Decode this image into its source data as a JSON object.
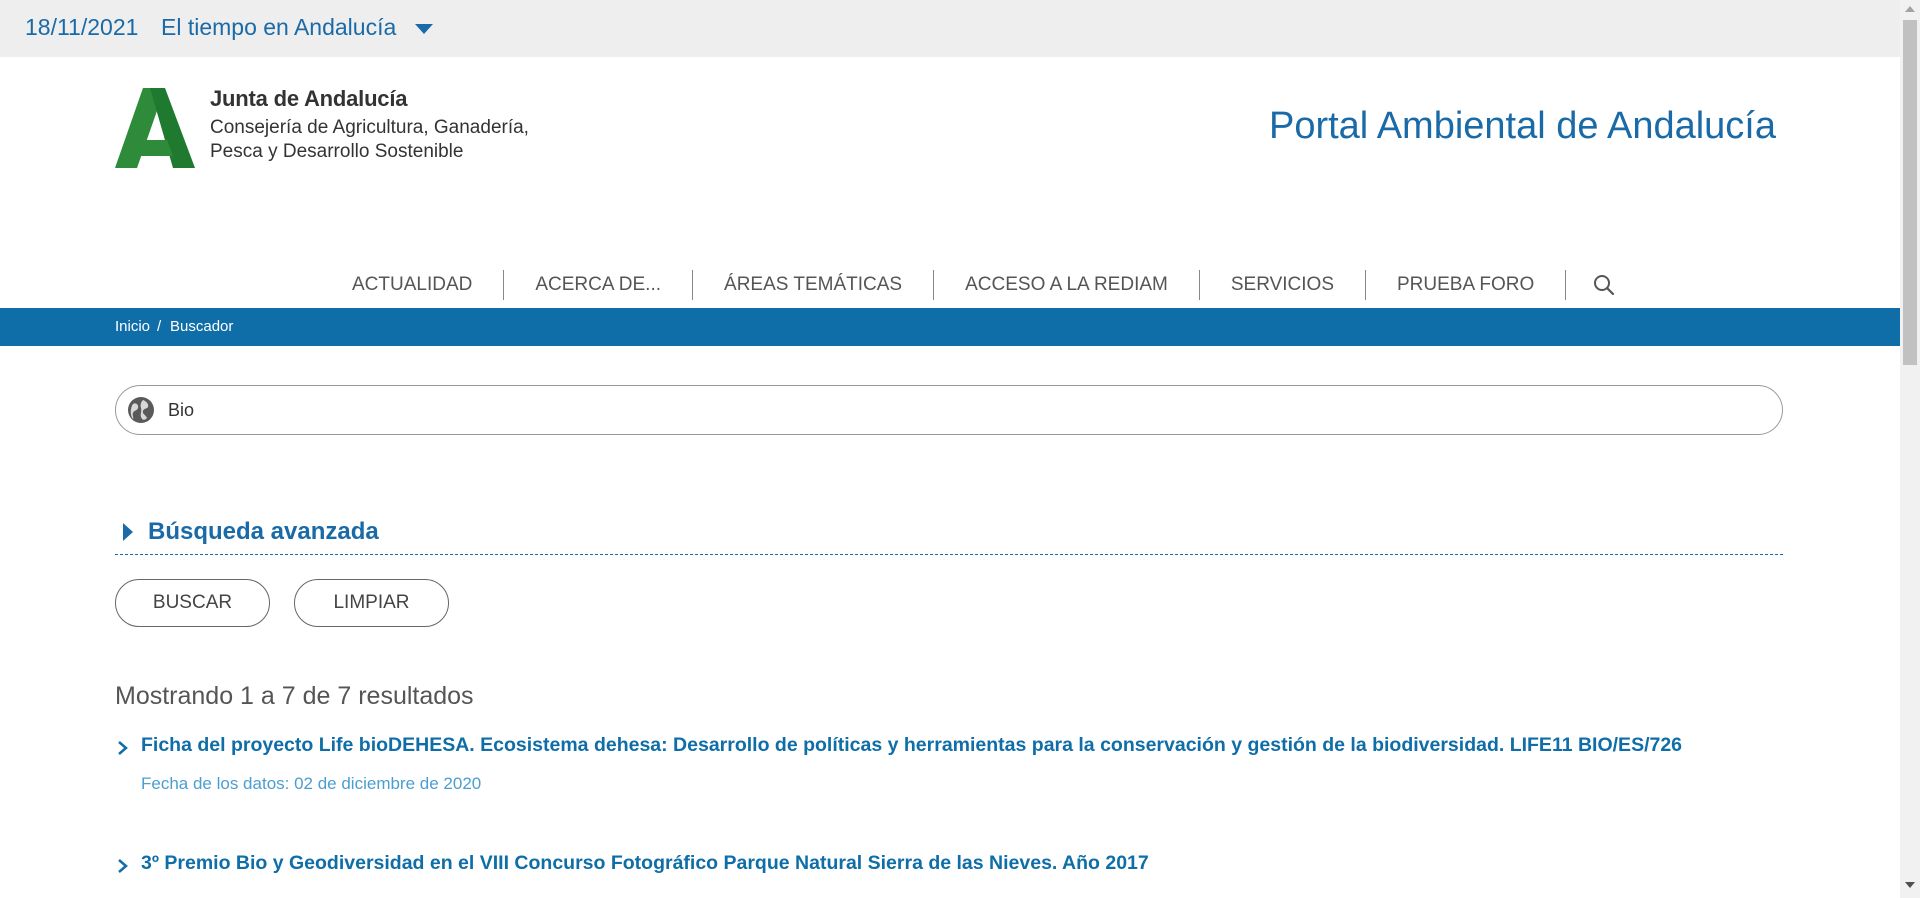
{
  "topbar": {
    "date": "18/11/2021",
    "weather_link": "El tiempo en Andalucía"
  },
  "header": {
    "org_name": "Junta de Andalucía",
    "dept_line1": "Consejería de Agricultura, Ganadería,",
    "dept_line2": "Pesca y Desarrollo Sostenible",
    "portal_title": "Portal Ambiental de Andalucía"
  },
  "nav": {
    "items": [
      {
        "label": "ACTUALIDAD"
      },
      {
        "label": "ACERCA DE..."
      },
      {
        "label": "ÁREAS TEMÁTICAS"
      },
      {
        "label": "ACCESO A LA REDIAM"
      },
      {
        "label": "SERVICIOS"
      },
      {
        "label": "PRUEBA FORO"
      }
    ]
  },
  "breadcrumb": {
    "home": "Inicio",
    "separator": "/",
    "current": "Buscador"
  },
  "search": {
    "value": "Bio"
  },
  "advanced": {
    "label": "Búsqueda avanzada"
  },
  "buttons": {
    "search": "BUSCAR",
    "clear": "LIMPIAR"
  },
  "results": {
    "count_text": "Mostrando 1 a 7 de 7 resultados",
    "items": [
      {
        "title": "Ficha del proyecto Life bioDEHESA. Ecosistema dehesa: Desarrollo de políticas y herramientas para la conservación y gestión de la biodiversidad. LIFE11 BIO/ES/726",
        "meta": "Fecha de los datos: 02 de diciembre de 2020"
      },
      {
        "title": "3º Premio Bio y Geodiversidad en el VIII Concurso Fotográfico Parque Natural Sierra de las Nieves. Año 2017"
      }
    ]
  },
  "colors": {
    "brand_blue": "#0f6ea8",
    "link_blue": "#1a6aa8",
    "logo_green": "#2e8b3a"
  }
}
